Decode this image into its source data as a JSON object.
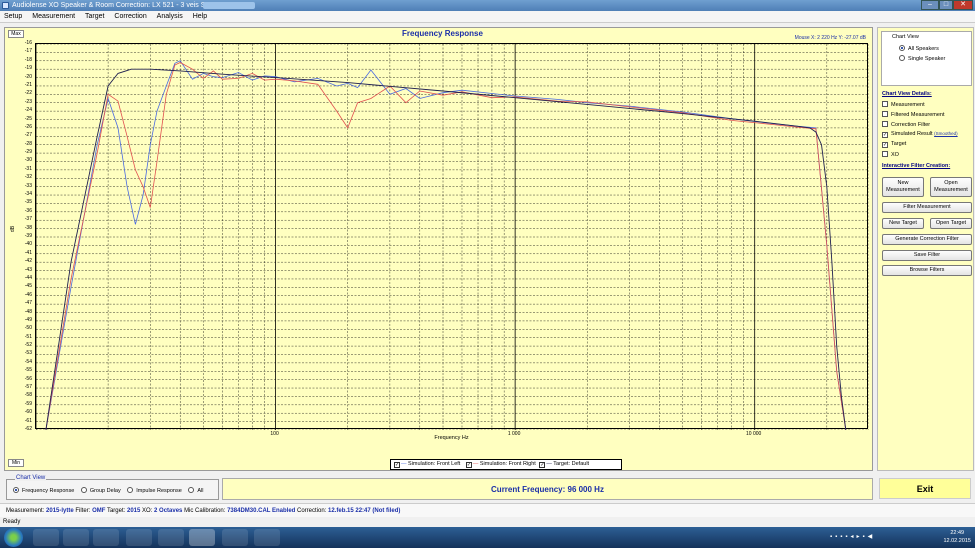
{
  "window": {
    "title": "Audiolense XO Speaker & Room Correction: LX 521 - 3 veis Setup",
    "minimize": "–",
    "maximize": "□",
    "close": "✕"
  },
  "menu": [
    "Setup",
    "Measurement",
    "Target",
    "Correction",
    "Analysis",
    "Help"
  ],
  "chart": {
    "max_tag": "Max",
    "min_tag": "Min",
    "mouse_readout": "Mouse X: 2 220 Hz   Y: -27.07 dB",
    "legend": [
      "Simulation: Front Left",
      "Simulation: Front Right",
      "Target: Default"
    ]
  },
  "chart_data": {
    "type": "line",
    "title": "Frequency Response",
    "xlabel": "Frequency Hz",
    "ylabel": "dB",
    "x_scale": "log",
    "xlim": [
      10,
      30000
    ],
    "ylim": [
      -62,
      -16
    ],
    "y_ticks": [
      -16,
      -17,
      -18,
      -19,
      -20,
      -21,
      -22,
      -23,
      -24,
      -25,
      -26,
      -27,
      -28,
      -29,
      -30,
      -31,
      -32,
      -33,
      -34,
      -35,
      -36,
      -37,
      -38,
      -39,
      -40,
      -41,
      -42,
      -43,
      -44,
      -45,
      -46,
      -47,
      -48,
      -49,
      -50,
      -51,
      -52,
      -53,
      -54,
      -55,
      -56,
      -57,
      -58,
      -59,
      -60,
      -61,
      -62
    ],
    "x_tick_labels": [
      {
        "value": 100,
        "label": "100"
      },
      {
        "value": 1000,
        "label": "1 000"
      },
      {
        "value": 10000,
        "label": "10 000"
      }
    ],
    "grid": true,
    "series": [
      {
        "name": "Simulation: Front Left",
        "color": "#4a6ae0",
        "x": [
          11,
          14,
          18,
          20,
          22,
          24,
          26,
          28,
          30,
          32,
          35,
          38,
          40,
          45,
          50,
          55,
          60,
          70,
          80,
          90,
          100,
          120,
          150,
          180,
          200,
          220,
          250,
          300,
          350,
          400,
          500,
          600,
          800,
          1000,
          1500,
          2000,
          3000,
          5000,
          8000,
          12000,
          15000,
          18000,
          20000,
          22000,
          24000
        ],
        "y": [
          -62,
          -45,
          -28,
          -22.5,
          -26,
          -33,
          -37.5,
          -34,
          -28,
          -24,
          -21,
          -18.3,
          -18,
          -20.2,
          -19.5,
          -19.9,
          -20,
          -19.4,
          -20.3,
          -19.8,
          -19.9,
          -20.5,
          -20.1,
          -21,
          -20.7,
          -21.2,
          -19.1,
          -22,
          -21.3,
          -22.5,
          -21.8,
          -21.5,
          -21.9,
          -22.2,
          -22.6,
          -23,
          -23.4,
          -24.1,
          -24.9,
          -25.5,
          -25.8,
          -26,
          -40,
          -55,
          -62
        ]
      },
      {
        "name": "Simulation: Front Right",
        "color": "#e05050",
        "x": [
          11,
          14,
          18,
          20,
          22,
          24,
          26,
          28,
          30,
          32,
          35,
          38,
          40,
          45,
          50,
          55,
          60,
          70,
          80,
          90,
          100,
          120,
          150,
          180,
          200,
          220,
          250,
          300,
          350,
          400,
          500,
          600,
          800,
          1000,
          1500,
          2000,
          3000,
          5000,
          8000,
          12000,
          15000,
          18000,
          20000,
          22000,
          24000
        ],
        "y": [
          -62,
          -44,
          -29,
          -22,
          -22.8,
          -27,
          -31,
          -33,
          -35.5,
          -30,
          -22,
          -18.5,
          -18.2,
          -19,
          -20.1,
          -19.2,
          -20.2,
          -20.1,
          -19.5,
          -20.3,
          -20.2,
          -20.4,
          -20.8,
          -24,
          -26,
          -23,
          -22.5,
          -21,
          -23,
          -21.6,
          -22.1,
          -21.7,
          -22.4,
          -22.3,
          -22.8,
          -22.9,
          -23.5,
          -24.2,
          -25.1,
          -25.6,
          -25.9,
          -26.1,
          -40,
          -55,
          -62
        ]
      },
      {
        "name": "Target: Default",
        "color": "#202050",
        "x": [
          11,
          14,
          18,
          20,
          22,
          25,
          30,
          40,
          60,
          100,
          200,
          500,
          1000,
          2000,
          5000,
          10000,
          15000,
          17000,
          18000,
          19000,
          20000,
          21000,
          22000,
          23000,
          24000
        ],
        "y": [
          -62,
          -42,
          -27,
          -21,
          -19.5,
          -19,
          -19,
          -19.2,
          -19.6,
          -20,
          -20.6,
          -21.6,
          -22.4,
          -23.2,
          -24.3,
          -25.2,
          -25.8,
          -26,
          -26.5,
          -28,
          -33,
          -42,
          -52,
          -58,
          -62
        ]
      }
    ]
  },
  "sidebar": {
    "chart_view": {
      "title": "Chart View",
      "options": [
        "All Speakers",
        "Single Speaker"
      ],
      "selected": "All Speakers"
    },
    "details": {
      "heading": "Chart View Details:",
      "items": [
        {
          "label": "Measurement",
          "checked": false
        },
        {
          "label": "Filtered Measurement",
          "checked": false
        },
        {
          "label": "Correction Filter",
          "checked": false
        },
        {
          "label": "Simulated Result",
          "checked": true
        },
        {
          "label": "Target",
          "checked": true
        },
        {
          "label": "XO",
          "checked": false
        }
      ],
      "smoothed_link": "(Smoothed)"
    },
    "filter_creation": {
      "heading": "Interactive Filter Creation:",
      "new_measurement": "New Measurement",
      "open_measurement": "Open Measurement",
      "filter_measurement": "Filter Measurement",
      "new_target": "New Target",
      "open_target": "Open Target",
      "generate": "Generate Correction Filter",
      "save": "Save Filter",
      "browse": "Browse Filters"
    }
  },
  "bottom": {
    "chart_view_label": "Chart View",
    "options": [
      "Frequency Response",
      "Group Delay",
      "Impulse Response",
      "All"
    ],
    "selected": "Frequency Response",
    "current_frequency": "Current Frequency: 96 000 Hz",
    "exit": "Exit"
  },
  "info": {
    "measurement_label": "Measurement:",
    "measurement": "2015-lytte",
    "filter_label": "Filter:",
    "filter": "OMF",
    "target_label": "Target:",
    "target": "2015",
    "xo_label": "XO:",
    "xo": "2 Octaves",
    "mic_label": "Mic Calibration:",
    "mic": "7384DM30.CAL Enabled",
    "correction_label": "Correction:",
    "correction": "12.feb.15 22:47 (Not filed)"
  },
  "status": "Ready",
  "taskbar": {
    "time": "22:49",
    "date": "12.02.2015"
  }
}
